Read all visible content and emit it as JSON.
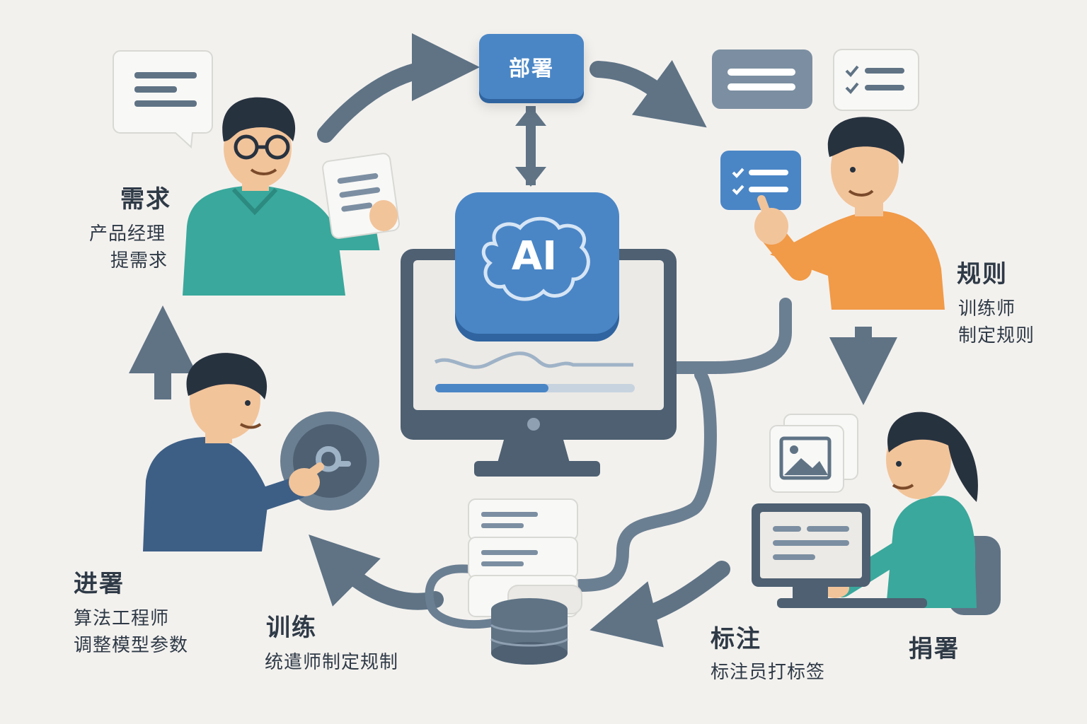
{
  "center": {
    "ai_label": "AI"
  },
  "deploy": {
    "label": "部署"
  },
  "requirement": {
    "title": "需求",
    "desc_line1": "产品经理",
    "desc_line2": "提需求"
  },
  "rules": {
    "title": "规则",
    "desc_line1": "训练师",
    "desc_line2": "制定规则"
  },
  "annotation": {
    "title": "标注",
    "desc": "标注员打标签"
  },
  "annotation_extra": {
    "title": "捐署"
  },
  "training": {
    "title": "训练",
    "desc": "统遣师制定规制"
  },
  "tuning": {
    "title": "进署",
    "desc_line1": "算法工程师",
    "desc_line2": "调整模型参数"
  },
  "colors": {
    "accent_blue": "#4a86c6",
    "slate": "#5f7385",
    "teal": "#3aa89c",
    "orange": "#f19a48",
    "navy": "#3d5f86"
  }
}
